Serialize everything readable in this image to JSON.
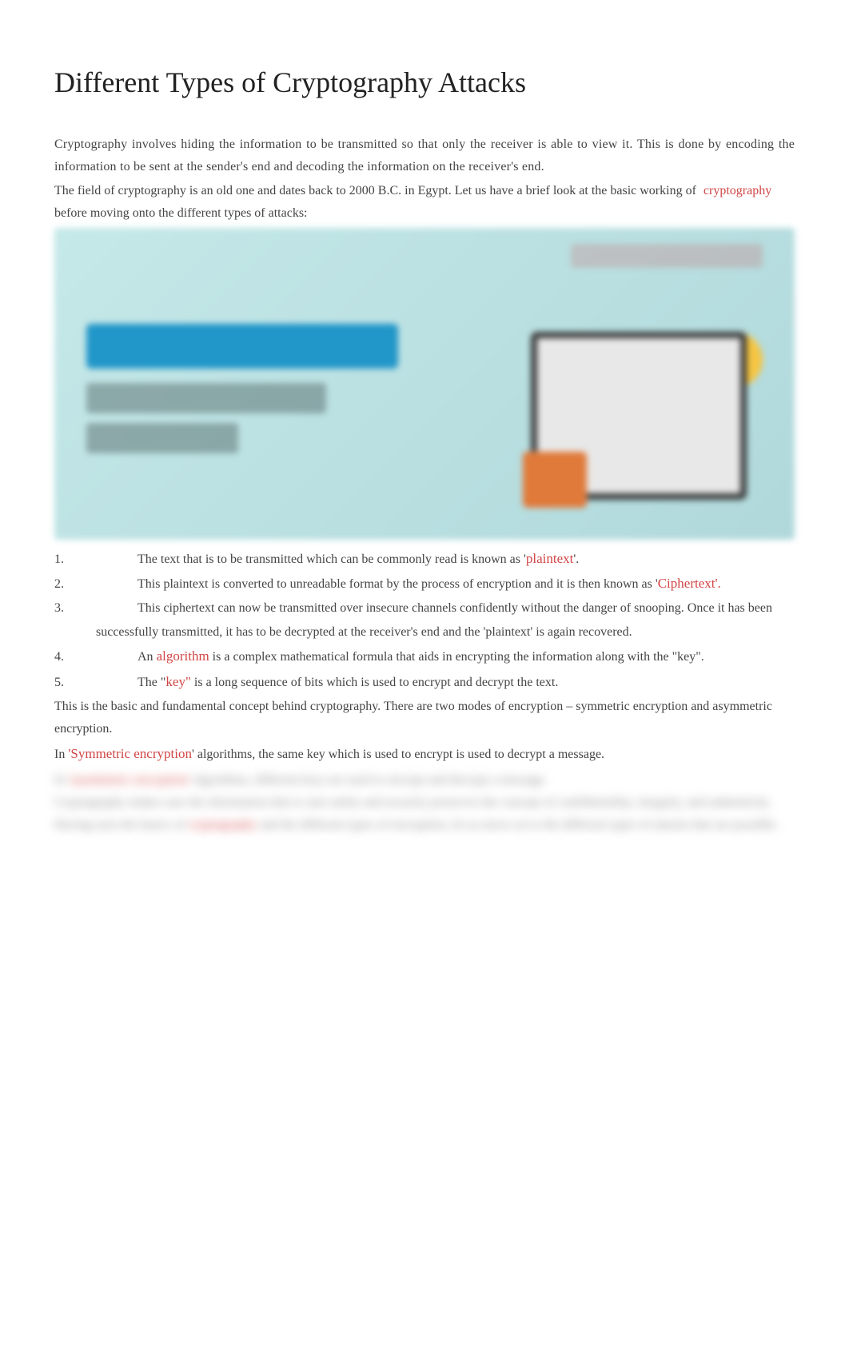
{
  "title": "Different Types of Cryptography Attacks",
  "intro1": "Cryptography involves hiding the information to be transmitted so that only the receiver is able to view it. This is done by encoding the information to be sent at the sender's end and decoding the information on the receiver's end.",
  "intro2_a": "The field of cryptography is an old one and dates back to 2000 B.C. in Egypt. Let us have a brief look at the basic working of ",
  "intro2_highlight": "cryptography",
  "intro2_b": " before moving onto the different types of attacks:",
  "list": {
    "item1_a": "The text that is to be transmitted which can be commonly read is known as '",
    "item1_term": "plaintext",
    "item1_b": "'.",
    "item2_a": "This plaintext is converted to unreadable format by the process of encryption and it is then known as '",
    "item2_term": "Ciphertext'.",
    "item3": "This ciphertext can now be transmitted over insecure channels confidently without the danger of snooping. Once it has been successfully transmitted, it has to be decrypted at the receiver's end and the 'plaintext' is again recovered.",
    "item4_a": "An ",
    "item4_term": "algorithm",
    "item4_b": " is a complex mathematical formula that aids in encrypting the information along with the \"key\".",
    "item5_a": "The \"",
    "item5_term": "key\"",
    "item5_b": " is a long sequence of bits which is used to encrypt and decrypt the text."
  },
  "para2": "This is the basic and fundamental concept behind cryptography. There are two modes of encryption – symmetric encryption and asymmetric encryption.",
  "para3_a": "In ",
  "para3_term": "'Symmetric encryption",
  "para3_b": "' algorithms, the same key which is used to encrypt is used to decrypt a message.",
  "blurred": {
    "line1_a": "In ",
    "line1_term": "'asymmetric encryption'",
    "line1_b": " algorithms, different keys are used to encrypt and decrypt a message.",
    "line2": "Cryptography makes sure the information that is sent safely and securely preserves the concept of confidentiality, integrity, and authenticity. Having seen the basics of",
    "line2_term": "cryptography",
    "line2_b": " and the different types of encryption, let us move on to the different types of attacks that are possible."
  }
}
